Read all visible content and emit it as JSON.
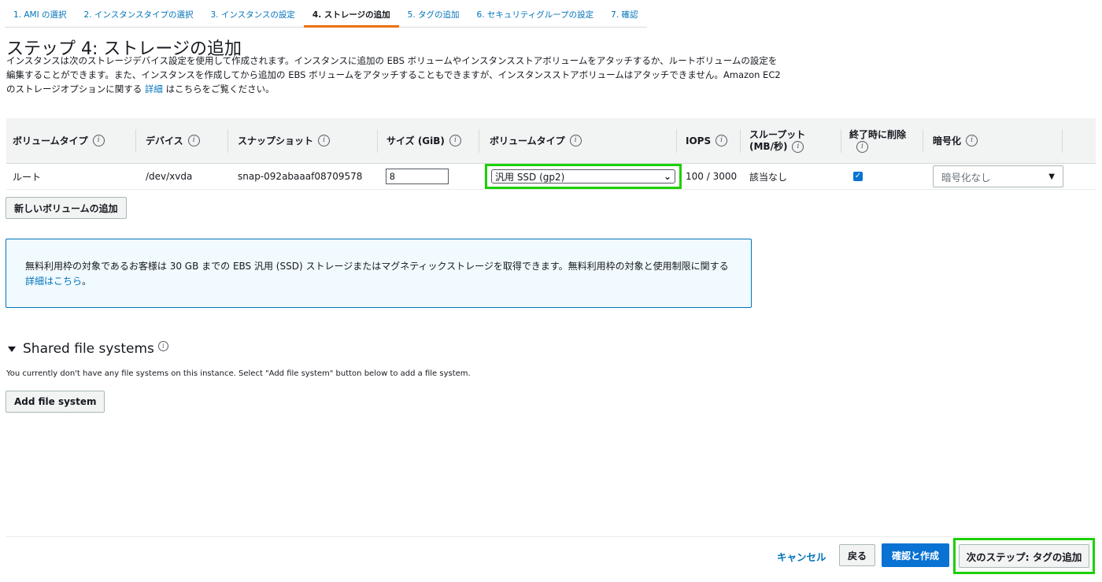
{
  "steps": [
    {
      "label": "1. AMI の選択"
    },
    {
      "label": "2. インスタンスタイプの選択"
    },
    {
      "label": "3. インスタンスの設定"
    },
    {
      "label": "4. ストレージの追加"
    },
    {
      "label": "5. タグの追加"
    },
    {
      "label": "6. セキュリティグループの設定"
    },
    {
      "label": "7. 確認"
    }
  ],
  "page": {
    "title": "ステップ 4: ストレージの追加",
    "description_part1": "インスタンスは次のストレージデバイス設定を使用して作成されます。インスタンスに追加の EBS ボリュームやインスタンスストアボリュームをアタッチするか、ルートボリュームの設定を編集することができます。また、インスタンスを作成してから追加の EBS ボリュームをアタッチすることもできますが、インスタンスストアボリュームはアタッチできません。Amazon EC2 のストレージオプションに関する",
    "description_link": "詳細",
    "description_part2": "はこちらをご覧ください。"
  },
  "table": {
    "headers": {
      "volume_type": "ボリュームタイプ",
      "device": "デバイス",
      "snapshot": "スナップショット",
      "size": "サイズ (GiB)",
      "volume_type2": "ボリュームタイプ",
      "iops": "IOPS",
      "throughput_line1": "スループット",
      "throughput_line2": "(MB/秒)",
      "delete_on_term": "終了時に削除",
      "encryption": "暗号化"
    },
    "row": {
      "volume_type": "ルート",
      "device": "/dev/xvda",
      "snapshot": "snap-092abaaaf08709578",
      "size": "8",
      "volume_type_selected": "汎用 SSD (gp2)",
      "iops": "100 / 3000",
      "throughput": "該当なし",
      "delete_on_term": true,
      "encryption": "暗号化なし"
    }
  },
  "buttons": {
    "add_volume": "新しいボリュームの追加",
    "add_file_system": "Add file system",
    "cancel": "キャンセル",
    "back": "戻る",
    "review_launch": "確認と作成",
    "next": "次のステップ: タグの追加"
  },
  "info_box": {
    "text": "無料利用枠の対象であるお客様は 30 GB までの EBS 汎用 (SSD) ストレージまたはマグネティックストレージを取得できます。無料利用枠の対象と使用制限に関する",
    "link": "詳細はこちら",
    "suffix": "。"
  },
  "shared_fs": {
    "title": "Shared file systems",
    "description": "You currently don't have any file systems on this instance. Select \"Add file system\" button below to add a file system."
  },
  "icons": {
    "info": "i",
    "check": "✓",
    "dropdown": "▼",
    "select_arrow": "⌄"
  },
  "colors": {
    "accent": "#ec7211",
    "link": "#0073bb",
    "primary": "#0972d3",
    "highlight": "#1bd000"
  }
}
